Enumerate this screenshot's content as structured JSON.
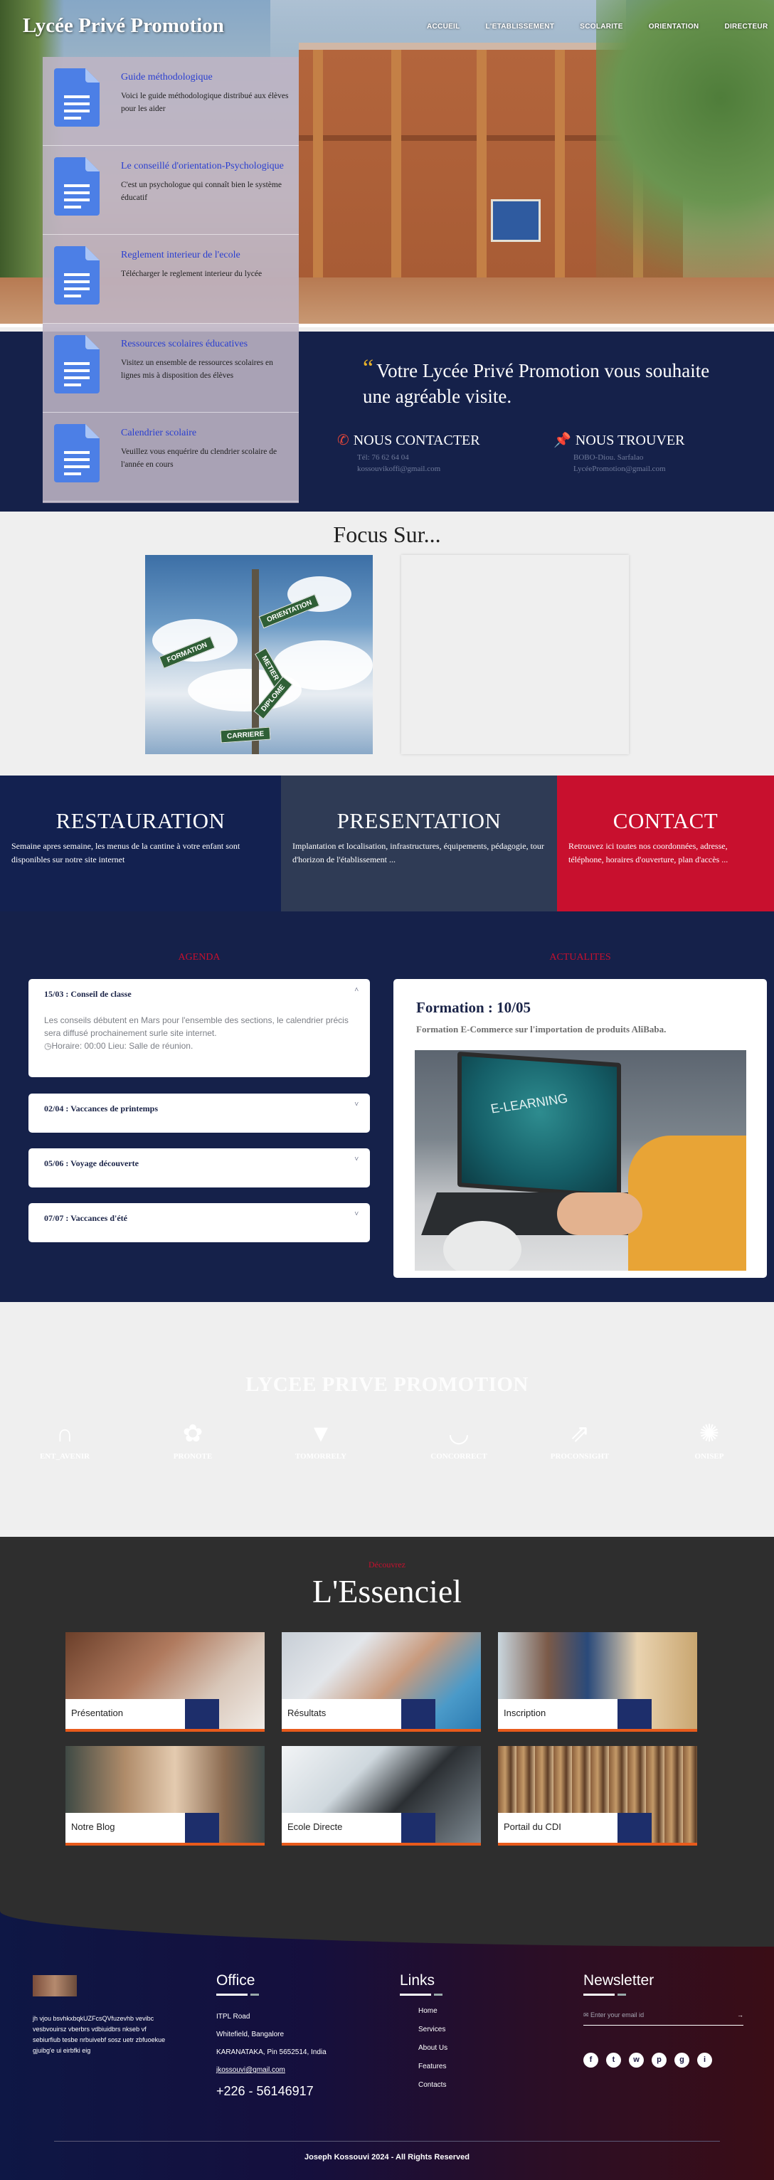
{
  "header": {
    "title": "Lycée Privé Promotion",
    "nav": [
      "ACCUEIL",
      "L'ETABLISSEMENT",
      "SCOLARITE",
      "ORIENTATION",
      "DIRECTEUR"
    ]
  },
  "sidebar": {
    "items": [
      {
        "title": "Guide méthodologique",
        "desc": "Voici le guide méthodologique distribué aux élèves pour les aider",
        "icon": "document-icon"
      },
      {
        "title": "Le conseillé d'orientation-Psychologique",
        "desc": "C'est un psychologue qui connaît bien le système éducatif",
        "icon": "document-icon"
      },
      {
        "title": "Reglement interieur de l'ecole",
        "desc": "Télécharger le reglement interieur du lycée",
        "icon": "document-icon"
      },
      {
        "title": "Ressources scolaires éducatives",
        "desc": "Visitez un ensemble de ressources scolaires en lignes mis à disposition des élèves",
        "icon": "document-icon"
      },
      {
        "title": "Calendrier scolaire",
        "desc": "Veuillez vous enquérire du clendrier scolaire de l'année en cours",
        "icon": "document-icon"
      }
    ]
  },
  "welcome": {
    "quote": "Votre Lycée Privé Promotion vous souhaite une agréable visite.",
    "contact": {
      "title": "NOUS CONTACTER",
      "phone": "Tél: 76 62 64 04",
      "email": "kossouvikoffi@gmail.com"
    },
    "location": {
      "title": "NOUS TROUVER",
      "city": "BOBO-Diou. Sarfalao",
      "email": "LycéePromotion@gmail.com"
    }
  },
  "focus": {
    "title": "Focus Sur...",
    "signs": [
      "ORIENTATION",
      "FORMATION",
      "METIER",
      "DIPLOME",
      "CARRIERE"
    ]
  },
  "panels": [
    {
      "title": "RESTAURATION",
      "text": "Semaine apres semaine, les menus de la cantine à votre enfant sont disponibles sur notre site internet",
      "color": "#132150"
    },
    {
      "title": "PRESENTATION",
      "text": "Implantation et localisation, infrastructures, équipements, pédagogie, tour d'horizon de l'établissement ...",
      "color": "#2f3b55"
    },
    {
      "title": "CONTACT",
      "text": "Retrouvez ici toutes nos coordonnées, adresse, téléphone, horaires d'ouverture, plan d'accès ...",
      "color": "#c8102e"
    }
  ],
  "agenda": {
    "label": "AGENDA",
    "items": [
      {
        "title": "15/03 : Conseil de classe",
        "body": "Les conseils débutent en Mars pour l'ensemble des sections, le calendrier précis sera diffusé prochainement surle site internet.",
        "info": "Horaire: 00:00  Lieu: Salle de réunion."
      },
      {
        "title": "02/04 : Vaccances de printemps"
      },
      {
        "title": "05/06 : Voyage découverte"
      },
      {
        "title": "07/07 : Vaccances d'été"
      }
    ]
  },
  "actualites": {
    "label": "ACTUALITES",
    "title": "Formation : 10/05",
    "subtitle": "Formation E-Commerce sur l'importation de produits AliBaba.",
    "screen_text": "E-LEARNING"
  },
  "logos": {
    "title": "LYCEE PRIVE PROMOTION",
    "items": [
      {
        "label": "ENT_AVENIR",
        "glyph": "∩"
      },
      {
        "label": "PRONOTE",
        "glyph": "✿"
      },
      {
        "label": "TOMORRELY",
        "glyph": "▼"
      },
      {
        "label": "CONCORRECT",
        "glyph": "◡"
      },
      {
        "label": "PROCONSIGHT",
        "glyph": "⇗"
      },
      {
        "label": "ONISEP",
        "glyph": "✺"
      }
    ]
  },
  "essenciel": {
    "small": "Découvrez",
    "title": "L'Essenciel",
    "tiles": [
      "Présentation",
      "Résultats",
      "Inscription",
      "Notre Blog",
      "Ecole Directe",
      "Portail du CDI"
    ]
  },
  "footer": {
    "about": "jh vjou bsvhkxbqkUZFcsQVfuzevhb vevibc vesbvouirsz vberbrs vdbiuidbrs nkseb vf sebiurfiub tesbe nrbuivebf sosz uetr zbfuoekue gjuibg'e ui eirbfki eig",
    "office": {
      "title": "Office",
      "l1": "ITPL Road",
      "l2": "Whitefield, Bangalore",
      "l3": "KARANATAKA, Pin 5652514, India",
      "email": "jkossouvi@gmail.com",
      "phone": "+226 - 56146917"
    },
    "links": {
      "title": "Links",
      "items": [
        "Home",
        "Services",
        "About Us",
        "Features",
        "Contacts"
      ]
    },
    "newsletter": {
      "title": "Newsletter",
      "placeholder": "Enter your email id",
      "socials": [
        "f",
        "t",
        "w",
        "p",
        "g",
        "i"
      ]
    },
    "copyright": "Joseph Kossouvi 2024 - All Rights Reserved"
  }
}
